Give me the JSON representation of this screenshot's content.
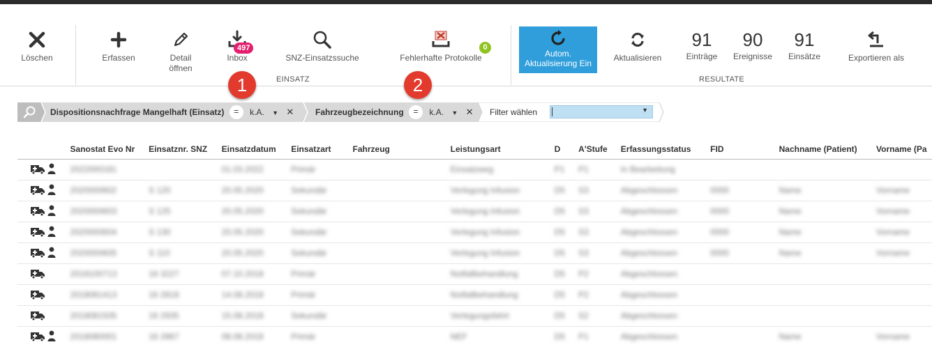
{
  "toolbar": {
    "loeschen": "Löschen",
    "erfassen": "Erfassen",
    "detail": "Detail\nöffnen",
    "inbox": "Inbox",
    "inbox_badge": "497",
    "snz": "SNZ-Einsatzssuche",
    "fehler": "Fehlerhafte Protokolle",
    "fehler_badge": "0",
    "group_einsatz": "EINSATZ",
    "auto": "Autom. Aktualisierung Ein",
    "aktualisieren": "Aktualisieren",
    "count_eintraege": "91",
    "label_eintraege": "Einträge",
    "count_ereignisse": "90",
    "label_ereignisse": "Ereignisse",
    "count_einsaetze": "91",
    "label_einsaetze": "Einsätze",
    "exportieren": "Exportieren als",
    "group_resultate": "RESULTATE"
  },
  "markers": [
    "1",
    "2"
  ],
  "filters": [
    {
      "label": "Dispositionsnachfrage Mangelhaft (Einsatz)",
      "op": "=",
      "value": "k.A."
    },
    {
      "label": "Fahrzeugbezeichnung",
      "op": "=",
      "value": "k.A."
    },
    {
      "label": "Filter wählen"
    }
  ],
  "table": {
    "columns": [
      "Sanostat Evo Nr",
      "Einsatznr. SNZ",
      "Einsatzdatum",
      "Einsatzart",
      "Fahrzeug",
      "Leistungsart",
      "D",
      "A'Stufe",
      "Erfassungsstatus",
      "FID",
      "Nachname (Patient)",
      "Vorname (Pa"
    ],
    "rows": [
      {
        "icons": "ambulance-person",
        "cells": [
          "2022000181",
          "",
          "01.03.2022",
          "Primär",
          "",
          "Einsatzweg",
          "P1",
          "P1",
          "In Bearbeitung",
          "",
          "",
          ""
        ]
      },
      {
        "icons": "ambulance-person",
        "cells": [
          "2020000602",
          "S 120",
          "20.05.2020",
          "Sekundär",
          "",
          "Verlegung Infusion",
          "D5",
          "S3",
          "Abgeschlossen",
          "0000",
          "Name",
          "Vorname"
        ]
      },
      {
        "icons": "ambulance-person",
        "cells": [
          "2020000603",
          "S 125",
          "20.05.2020",
          "Sekundär",
          "",
          "Verlegung Infusion",
          "D5",
          "S3",
          "Abgeschlossen",
          "0000",
          "Name",
          "Vorname"
        ]
      },
      {
        "icons": "ambulance-person",
        "cells": [
          "2020000604",
          "S 130",
          "20.05.2020",
          "Sekundär",
          "",
          "Verlegung Infusion",
          "D5",
          "S3",
          "Abgeschlossen",
          "0000",
          "Name",
          "Vorname"
        ]
      },
      {
        "icons": "ambulance-person",
        "cells": [
          "2020000605",
          "S 110",
          "20.05.2020",
          "Sekundär",
          "",
          "Verlegung Infusion",
          "D5",
          "S3",
          "Abgeschlossen",
          "0000",
          "Name",
          "Vorname"
        ]
      },
      {
        "icons": "ambulance",
        "cells": [
          "2018100713",
          "16 3227",
          "07.10.2018",
          "Primär",
          "",
          "Notfallbehandlung",
          "D5",
          "P2",
          "Abgeschlossen",
          "",
          "",
          ""
        ]
      },
      {
        "icons": "ambulance",
        "cells": [
          "2018081413",
          "16 2818",
          "14.08.2018",
          "Primär",
          "",
          "Notfallbehandlung",
          "D5",
          "P2",
          "Abgeschlossen",
          "",
          "",
          ""
        ]
      },
      {
        "icons": "ambulance",
        "cells": [
          "2018081505",
          "16 2935",
          "15.08.2018",
          "Sekundär",
          "",
          "Verlegungsfahrt",
          "D5",
          "S2",
          "Abgeschlossen",
          "",
          "",
          ""
        ]
      },
      {
        "icons": "ambulance-person",
        "cells": [
          "2018080001",
          "16 2867",
          "08.08.2018",
          "Primär",
          "",
          "NEF",
          "D5",
          "P1",
          "Abgeschlossen",
          "",
          "Name",
          "Vorname"
        ]
      }
    ]
  }
}
